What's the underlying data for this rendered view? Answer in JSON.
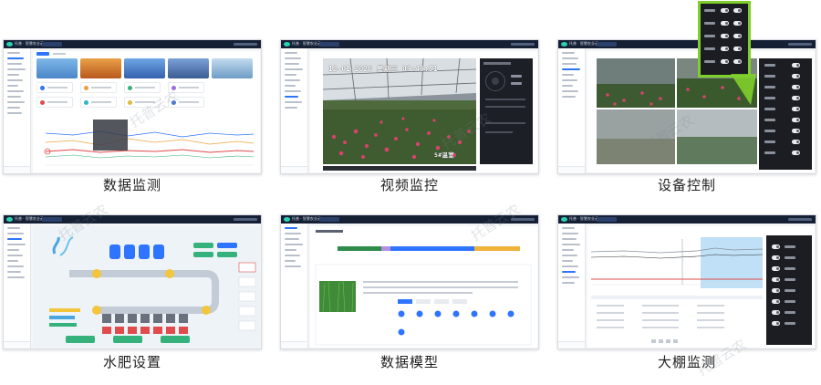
{
  "panels": [
    {
      "caption": "数据监测"
    },
    {
      "caption": "视频监控",
      "osd": "12-01-2020 星期三 09:49:51",
      "cam_label": "5#温室"
    },
    {
      "caption": "设备控制"
    },
    {
      "caption": "水肥设置"
    },
    {
      "caption": "数据模型"
    },
    {
      "caption": "大棚监测"
    }
  ],
  "watermark": "托普云农",
  "app_title": "托普 · 智慧农业云",
  "colors": {
    "accent": "#2f74ff",
    "nav": "#162035",
    "highlight": "#7fcf2a",
    "alert": "#e24b4b"
  }
}
